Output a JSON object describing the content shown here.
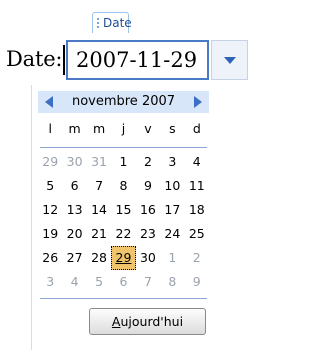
{
  "field_tag": "Date",
  "label": "Date:",
  "input_value": "2007-11-29",
  "calendar": {
    "month_title": "novembre 2007",
    "weekdays": [
      "l",
      "m",
      "m",
      "j",
      "v",
      "s",
      "d"
    ],
    "weeks": [
      [
        {
          "d": "29",
          "other": true
        },
        {
          "d": "30",
          "other": true
        },
        {
          "d": "31",
          "other": true
        },
        {
          "d": "1"
        },
        {
          "d": "2"
        },
        {
          "d": "3"
        },
        {
          "d": "4"
        }
      ],
      [
        {
          "d": "5"
        },
        {
          "d": "6"
        },
        {
          "d": "7"
        },
        {
          "d": "8"
        },
        {
          "d": "9"
        },
        {
          "d": "10"
        },
        {
          "d": "11"
        }
      ],
      [
        {
          "d": "12"
        },
        {
          "d": "13"
        },
        {
          "d": "14"
        },
        {
          "d": "15"
        },
        {
          "d": "16"
        },
        {
          "d": "17"
        },
        {
          "d": "18"
        }
      ],
      [
        {
          "d": "19"
        },
        {
          "d": "20"
        },
        {
          "d": "21"
        },
        {
          "d": "22"
        },
        {
          "d": "23"
        },
        {
          "d": "24"
        },
        {
          "d": "25"
        }
      ],
      [
        {
          "d": "26"
        },
        {
          "d": "27"
        },
        {
          "d": "28"
        },
        {
          "d": "29",
          "selected": true
        },
        {
          "d": "30"
        },
        {
          "d": "1",
          "other": true
        },
        {
          "d": "2",
          "other": true
        }
      ],
      [
        {
          "d": "3",
          "other": true
        },
        {
          "d": "4",
          "other": true
        },
        {
          "d": "5",
          "other": true
        },
        {
          "d": "6",
          "other": true
        },
        {
          "d": "7",
          "other": true
        },
        {
          "d": "8",
          "other": true
        },
        {
          "d": "9",
          "other": true
        }
      ]
    ],
    "today_button": {
      "first": "A",
      "rest": "ujourd'hui"
    }
  },
  "colors": {
    "accent": "#4a79c8",
    "header_bg": "#d7e6f8",
    "selected_bg": "#f0c46b",
    "nav_arrow": "#3d6fc4",
    "other_month": "#9aa3ad"
  },
  "icons": {
    "prev": "triangle-left-icon",
    "next": "triangle-right-icon",
    "dropdown": "triangle-down-icon"
  }
}
